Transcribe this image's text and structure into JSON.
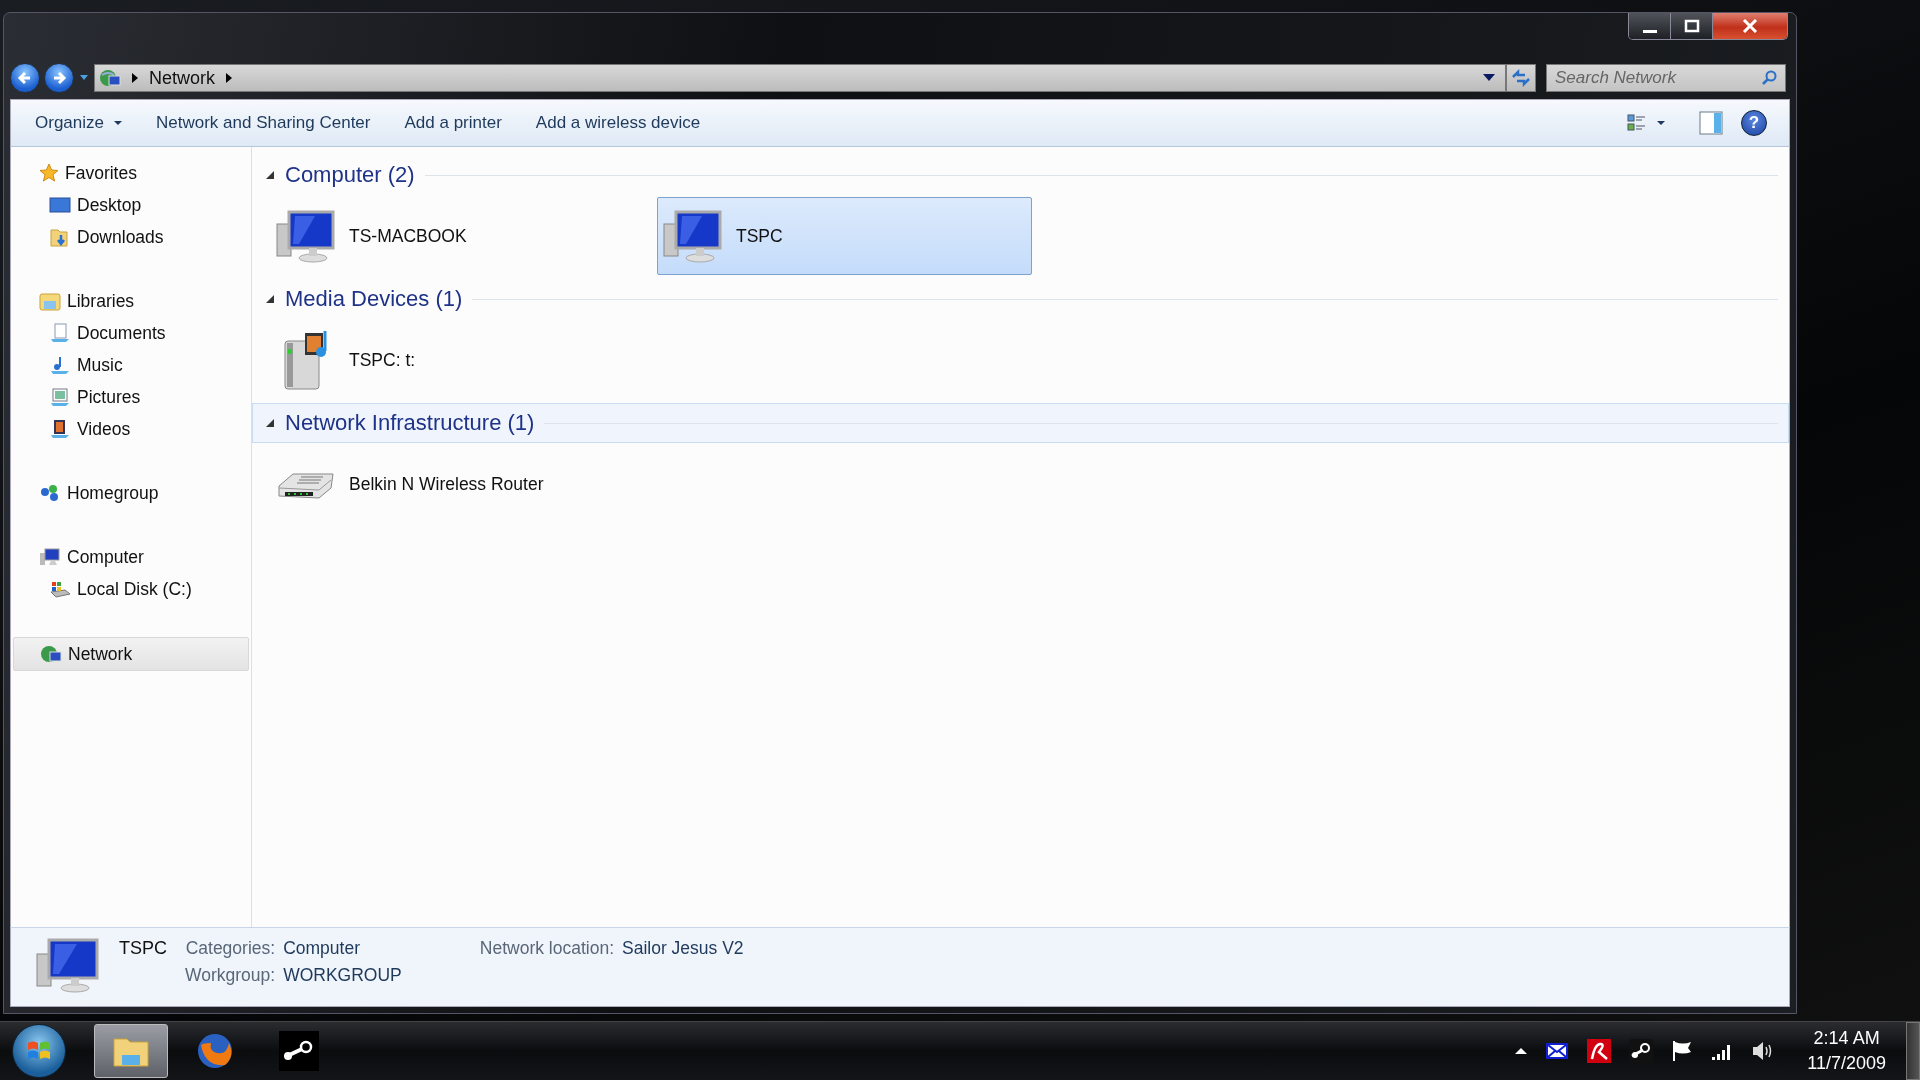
{
  "address": {
    "crumbs": [
      "Network"
    ],
    "search_placeholder": "Search Network"
  },
  "commands": [
    {
      "label": "Organize",
      "dropdown": true
    },
    {
      "label": "Network and Sharing Center",
      "dropdown": false
    },
    {
      "label": "Add a printer",
      "dropdown": false
    },
    {
      "label": "Add a wireless device",
      "dropdown": false
    }
  ],
  "sidebar": {
    "groups": [
      {
        "label": "Favorites",
        "kind": "star",
        "selected": false,
        "children": [
          {
            "label": "Desktop",
            "kind": "desktop",
            "selected": false
          },
          {
            "label": "Downloads",
            "kind": "downloads",
            "selected": false
          }
        ]
      },
      {
        "label": "Libraries",
        "kind": "libraries",
        "selected": false,
        "children": [
          {
            "label": "Documents",
            "kind": "documents",
            "selected": false
          },
          {
            "label": "Music",
            "kind": "music",
            "selected": false
          },
          {
            "label": "Pictures",
            "kind": "pictures",
            "selected": false
          },
          {
            "label": "Videos",
            "kind": "videos",
            "selected": false
          }
        ]
      },
      {
        "label": "Homegroup",
        "kind": "homegroup",
        "selected": false
      },
      {
        "label": "Computer",
        "kind": "computer",
        "selected": false,
        "children": [
          {
            "label": "Local Disk (C:)",
            "kind": "disk",
            "selected": false
          }
        ]
      },
      {
        "label": "Network",
        "kind": "network",
        "selected": true
      }
    ]
  },
  "help": "?",
  "groups": [
    {
      "title": "Computer (2)",
      "expanded": true,
      "selected": false,
      "items": [
        {
          "name": "TS-MACBOOK",
          "kind": "computer",
          "selected": false
        },
        {
          "name": "TSPC",
          "kind": "computer",
          "selected": true
        }
      ]
    },
    {
      "title": "Media Devices (1)",
      "expanded": true,
      "selected": false,
      "items": [
        {
          "name": "TSPC: t:",
          "kind": "media",
          "selected": false
        }
      ]
    },
    {
      "title": "Network Infrastructure (1)",
      "expanded": true,
      "selected": true,
      "items": [
        {
          "name": "Belkin N Wireless Router",
          "kind": "router",
          "selected": false
        }
      ]
    }
  ],
  "details": {
    "name": "TSPC",
    "fields": [
      {
        "label": "Categories:",
        "value": "Computer"
      },
      {
        "label": "Workgroup:",
        "value": "WORKGROUP"
      },
      {
        "label": "Network location:",
        "value": "Sailor Jesus V2"
      }
    ]
  },
  "taskbar": {
    "apps": [
      {
        "kind": "explorer",
        "active": true
      },
      {
        "kind": "firefox",
        "active": false
      },
      {
        "kind": "steam",
        "active": false
      }
    ],
    "tray": [
      {
        "kind": "mail"
      },
      {
        "kind": "antivirus"
      },
      {
        "kind": "steam"
      },
      {
        "kind": "flag"
      },
      {
        "kind": "signal"
      },
      {
        "kind": "volume"
      }
    ],
    "time": "2:14 AM",
    "date": "11/7/2009"
  }
}
